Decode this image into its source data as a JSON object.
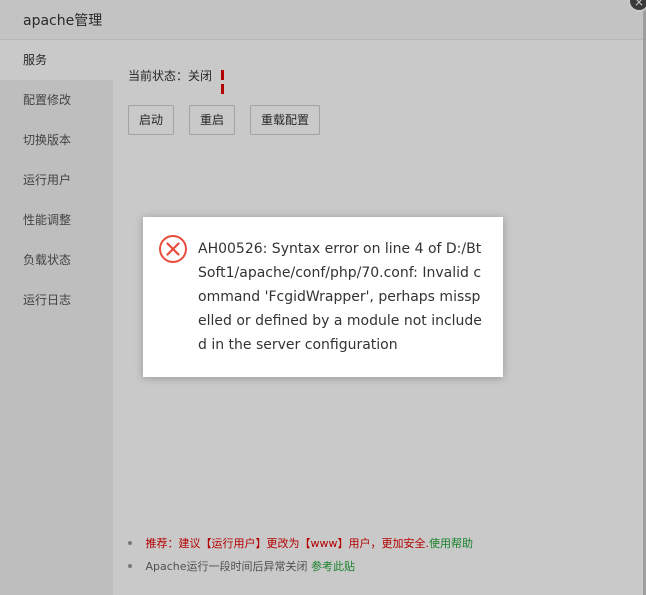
{
  "window": {
    "title": "apache管理",
    "close_symbol": "×"
  },
  "sidebar": {
    "items": [
      {
        "label": "服务",
        "active": true
      },
      {
        "label": "配置修改"
      },
      {
        "label": "切换版本"
      },
      {
        "label": "运行用户"
      },
      {
        "label": "性能调整"
      },
      {
        "label": "负载状态"
      },
      {
        "label": "运行日志"
      }
    ]
  },
  "service": {
    "status_label": "当前状态：",
    "status_value": "关闭",
    "status_icon": "pause-icon",
    "status_color": "#e60000",
    "buttons": {
      "start": "启动",
      "restart": "重启",
      "reload": "重载配置"
    }
  },
  "tips": {
    "tip1_text": "推荐：建议【运行用户】更改为【www】用户，更加安全.",
    "tip1_link": "使用帮助",
    "tip2_text": "Apache运行一段时间后异常关闭",
    "tip2_link": "参考此贴"
  },
  "error_dialog": {
    "icon": "error-circle-icon",
    "icon_color": "#e84c3d",
    "message": "AH00526: Syntax error on line 4 of D:/BtSoft1/apache/conf/php/70.conf: Invalid command 'FcgidWrapper', perhaps misspelled or defined by a module not included in the server configuration"
  }
}
